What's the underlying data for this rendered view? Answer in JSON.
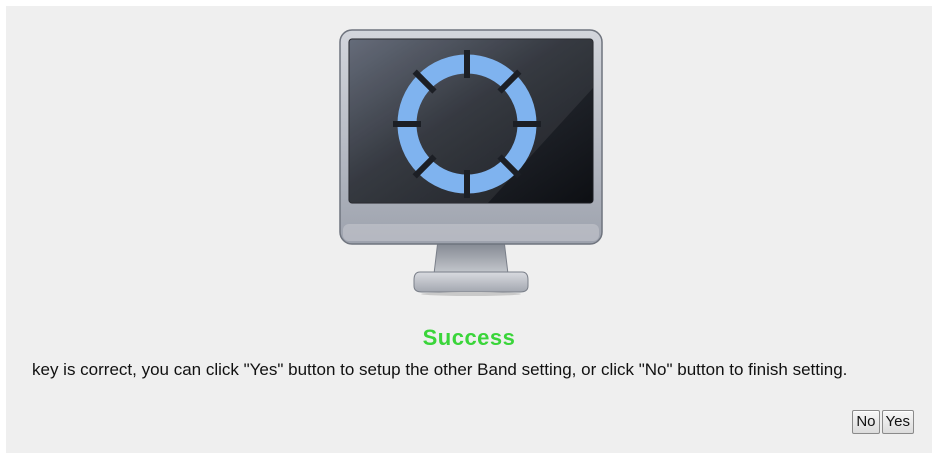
{
  "dialog": {
    "status_title": "Success",
    "message": "key is correct, you can click \"Yes\" button to setup the other Band setting, or click \"No\" button to finish setting.",
    "no_label": "No",
    "yes_label": "Yes"
  },
  "icon": "monitor-icon",
  "colors": {
    "success": "#3ad53a",
    "panel_background": "#efefef",
    "ring": "#7fb3ef"
  }
}
